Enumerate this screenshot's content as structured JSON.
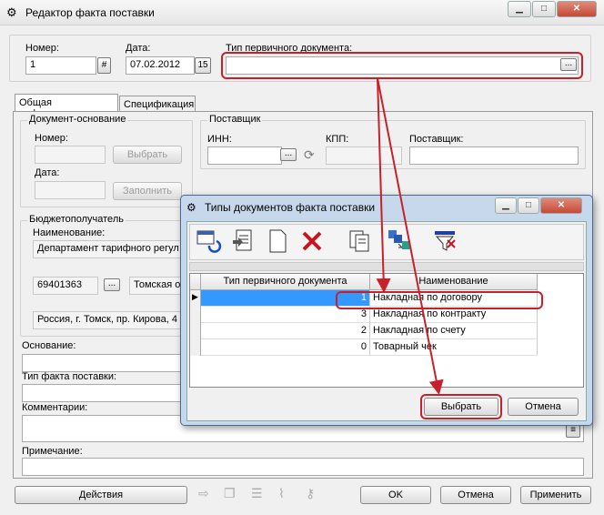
{
  "window": {
    "title": "Редактор факта поставки",
    "min": "▁",
    "max": "□",
    "close": "✕"
  },
  "header": {
    "number_label": "Номер:",
    "number_value": "1",
    "number_btn": "#",
    "date_label": "Дата:",
    "date_value": "07.02.2012",
    "date_btn": "15",
    "doc_type_label": "Тип первичного документа:",
    "doc_type_value": "",
    "doc_type_btn": "..."
  },
  "tabs": [
    "Общая информация",
    "Спецификация"
  ],
  "basis": {
    "group_label": "Документ-основание",
    "number_label": "Номер:",
    "date_label": "Дата:",
    "select_btn": "Выбрать",
    "fill_btn": "Заполнить"
  },
  "supplier": {
    "group_label": "Поставщик",
    "inn_label": "ИНН:",
    "inn_btn": "...",
    "kpp_label": "КПП:",
    "name_label": "Поставщик:"
  },
  "recipient": {
    "group_label": "Бюджетополучатель",
    "name_label": "Наименование:",
    "name_value": "Департамент тарифного регул",
    "code_value": "69401363",
    "code_btn": "...",
    "city_value": "Томская о",
    "address_value": "Россия, г. Томск, пр. Кирова, 4"
  },
  "fields": {
    "basis_label": "Основание:",
    "fact_type_label": "Тип факта поставки:",
    "comments_label": "Комментарии:",
    "note_label": "Примечание:"
  },
  "bottom": {
    "actions_btn": "Действия",
    "ok_btn": "OK",
    "cancel_btn": "Отмена",
    "apply_btn": "Применить"
  },
  "dialog": {
    "title": "Типы документов факта поставки",
    "columns": [
      "Тип первичного документа",
      "Наименование"
    ],
    "rows": [
      {
        "code": "1",
        "name": "Накладная по договору"
      },
      {
        "code": "3",
        "name": "Накладная по контракту"
      },
      {
        "code": "2",
        "name": "Накладная по счету"
      },
      {
        "code": "0",
        "name": "Товарный чек"
      }
    ],
    "select_btn": "Выбрать",
    "cancel_btn": "Отмена",
    "min": "▁",
    "max": "□",
    "close": "✕"
  },
  "colors": {
    "highlight": "#c8202a",
    "selection": "#3399ff"
  }
}
